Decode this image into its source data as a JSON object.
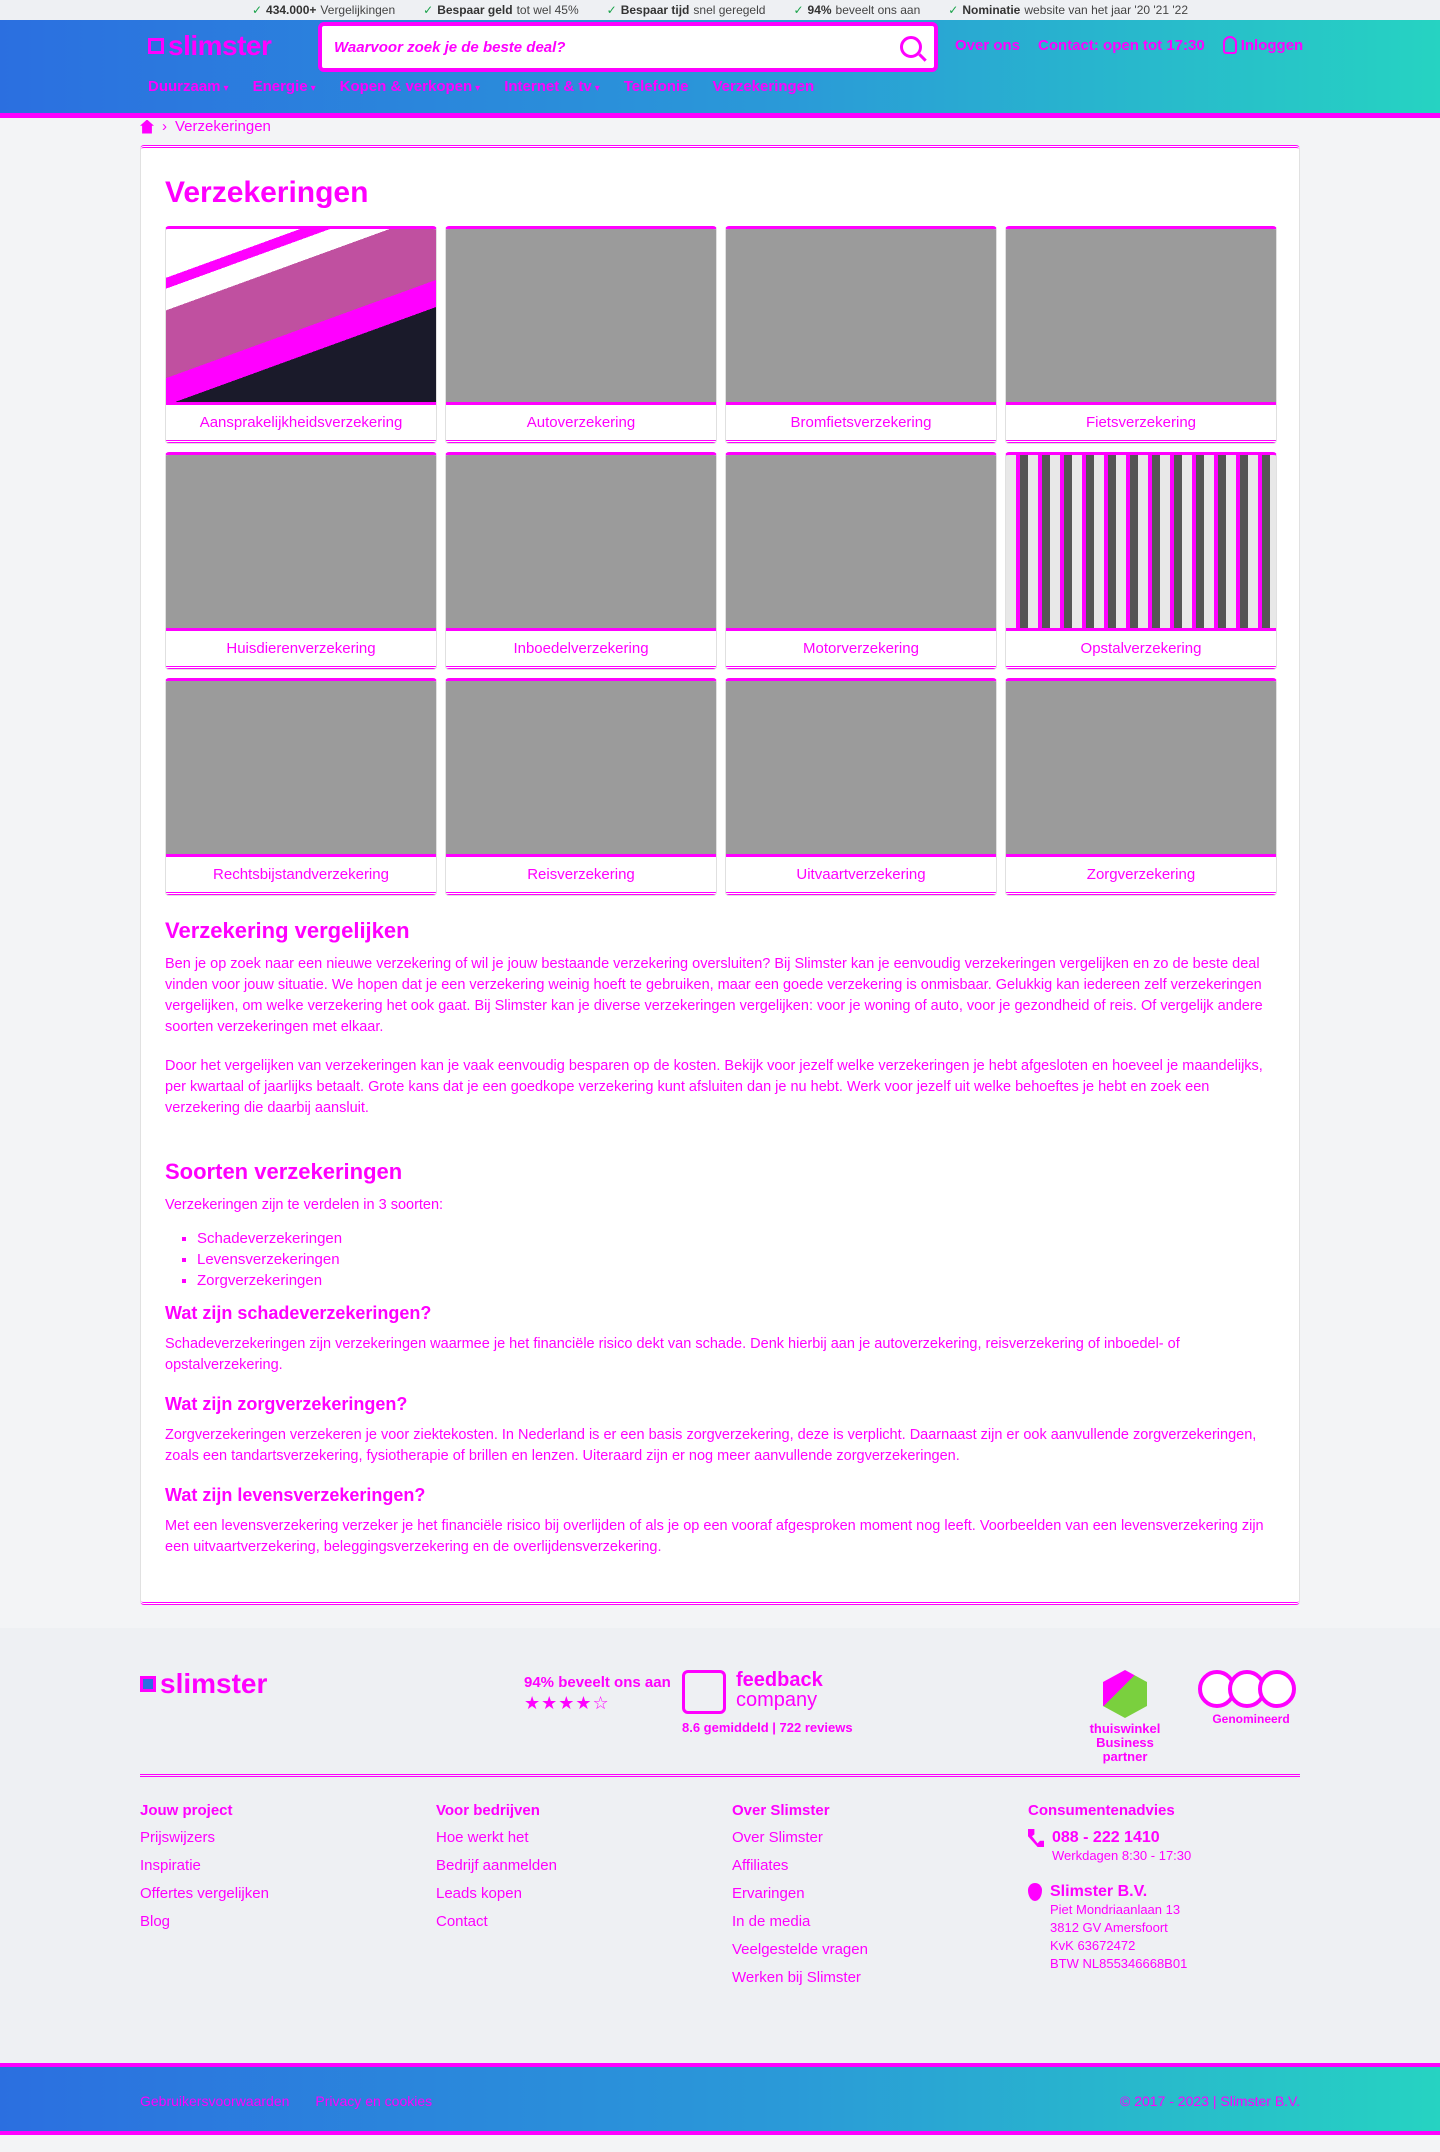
{
  "usp": [
    {
      "bold": "434.000+",
      "text": " Vergelijkingen"
    },
    {
      "bold": "Bespaar geld",
      "text": " tot wel 45%"
    },
    {
      "bold": "Bespaar tijd",
      "text": " snel geregeld"
    },
    {
      "bold": "94%",
      "text": " beveelt ons aan"
    },
    {
      "bold": "Nominatie",
      "text": " website van het jaar '20 '21 '22"
    }
  ],
  "header": {
    "logo": "slimster",
    "search_placeholder": "Waarvoor zoek je de beste deal?",
    "links": [
      "Over ons",
      "Contact: open tot 17:30",
      "Inloggen"
    ],
    "nav": [
      "Duurzaam",
      "Energie",
      "Kopen & verkopen",
      "Internet & tv",
      "Telefonie",
      "Verzekeringen"
    ]
  },
  "breadcrumb": {
    "current": "Verzekeringen"
  },
  "page": {
    "title": "Verzekeringen",
    "tiles": [
      "Aansprakelijkheidsverzekering",
      "Autoverzekering",
      "Bromfietsverzekering",
      "Fietsverzekering",
      "Huisdierenverzekering",
      "Inboedelverzekering",
      "Motorverzekering",
      "Opstalverzekering",
      "Rechtsbijstandverzekering",
      "Reisverzekering",
      "Uitvaartverzekering",
      "Zorgverzekering"
    ]
  },
  "content": {
    "h_compare": "Verzekering vergelijken",
    "p1": "Ben je op zoek naar een nieuwe verzekering of wil je jouw bestaande verzekering oversluiten? Bij Slimster kan je eenvoudig verzekeringen vergelijken en zo de beste deal vinden voor jouw situatie. We hopen dat je een verzekering weinig hoeft te gebruiken, maar een goede verzekering is onmisbaar. Gelukkig kan iedereen zelf verzekeringen vergelijken, om welke verzekering het ook gaat. Bij Slimster kan je diverse verzekeringen vergelijken: voor je woning of auto, voor je gezondheid of reis. Of vergelijk andere soorten verzekeringen met elkaar.",
    "p2": "Door het vergelijken van verzekeringen kan je vaak eenvoudig besparen op de kosten. Bekijk voor jezelf welke verzekeringen je hebt afgesloten en hoeveel je maandelijks, per kwartaal of jaarlijks betaalt. Grote kans dat je een goedkope verzekering kunt afsluiten dan je nu hebt. Werk voor jezelf uit welke behoeftes je hebt en zoek een verzekering die daarbij aansluit.",
    "h_types": "Soorten verzekeringen",
    "p_types": "Verzekeringen zijn te verdelen in 3 soorten:",
    "types": [
      "Schadeverzekeringen",
      "Levensverzekeringen",
      "Zorgverzekeringen"
    ],
    "q1": "Wat zijn schadeverzekeringen?",
    "a1": "Schadeverzekeringen zijn verzekeringen waarmee je het financiële risico dekt van schade. Denk hierbij aan je autoverzekering, reisverzekering of inboedel- of opstalverzekering.",
    "q2": "Wat zijn zorgverzekeringen?",
    "a2": "Zorgverzekeringen verzekeren je voor ziektekosten. In Nederland is er een basis zorgverzekering, deze is verplicht. Daarnaast zijn er ook aanvullende zorgverzekeringen, zoals een tandartsverzekering, fysiotherapie of brillen en lenzen. Uiteraard zijn er nog meer aanvullende zorgverzekeringen.",
    "q3": "Wat zijn levensverzekeringen?",
    "a3": "Met een levensverzekering verzeker je het financiële risico bij overlijden of als je op een vooraf afgesproken moment nog leeft. Voorbeelden van een levensverzekering zijn een uitvaartverzekering, beleggingsverzekering en de overlijdensverzekering."
  },
  "footer": {
    "logo": "slimster",
    "rate_text": "94% beveelt ons aan",
    "stars": "★★★★☆",
    "fb_title": "feedback",
    "fb_sub": "company",
    "fb_stats": "8.6 gemiddeld | 722 reviews",
    "badge1_title": "thuiswinkel",
    "badge1_sub": "Business partner",
    "badge2": "Genomineerd",
    "cols": [
      {
        "title": "Jouw project",
        "links": [
          "Prijswijzers",
          "Inspiratie",
          "Offertes vergelijken",
          "Blog"
        ]
      },
      {
        "title": "Voor bedrijven",
        "links": [
          "Hoe werkt het",
          "Bedrijf aanmelden",
          "Leads kopen",
          "Contact"
        ]
      },
      {
        "title": "Over Slimster",
        "links": [
          "Over Slimster",
          "Affiliates",
          "Ervaringen",
          "In de media",
          "Veelgestelde vragen",
          "Werken bij Slimster"
        ]
      }
    ],
    "advice_title": "Consumentenadvies",
    "phone": "088 - 222 1410",
    "hours": "Werkdagen 8:30 - 17:30",
    "company": "Slimster B.V.",
    "address": [
      "Piet Mondriaanlaan 13",
      "3812 GV Amersfoort",
      "KvK 63672472",
      "BTW NL855346668B01"
    ],
    "bottom_links": [
      "Gebruikersvoorwaarden",
      "Privacy en cookies"
    ],
    "copyright": "© 2017 - 2023 | Slimster B.V."
  }
}
